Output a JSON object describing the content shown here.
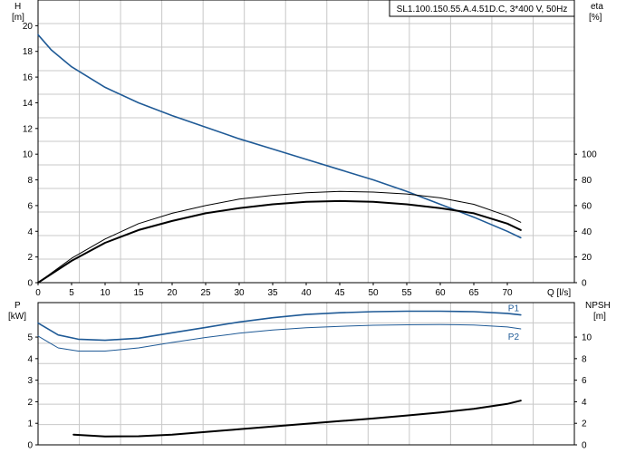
{
  "chart_data": [
    {
      "type": "line",
      "title": "SL1.100.150.55.A.4.51D.C, 3*400 V, 50Hz",
      "xlabel": "Q [l/s]",
      "x_ticks": [
        "0",
        "5",
        "10",
        "15",
        "20",
        "25",
        "30",
        "35",
        "40",
        "45",
        "50",
        "55",
        "60",
        "65",
        "70"
      ],
      "xlim": [
        0,
        80
      ],
      "left_axis": {
        "label_name": "H",
        "label_unit": "[m]",
        "ylim": [
          0,
          22
        ],
        "ticks": [
          "0",
          "2",
          "4",
          "6",
          "8",
          "10",
          "12",
          "14",
          "16",
          "18",
          "20"
        ]
      },
      "right_axis": {
        "label_name": "eta",
        "label_unit": "[%]",
        "ylim": [
          0,
          220
        ],
        "ticks": [
          "0",
          "20",
          "40",
          "60",
          "80",
          "100"
        ]
      },
      "grid": true,
      "series": [
        {
          "axis": "left",
          "color": "#1f5a96",
          "width": 1.6,
          "points": [
            [
              0,
              19.3
            ],
            [
              2,
              18.1
            ],
            [
              5,
              16.8
            ],
            [
              10,
              15.2
            ],
            [
              15,
              14.0
            ],
            [
              20,
              13.0
            ],
            [
              25,
              12.1
            ],
            [
              30,
              11.2
            ],
            [
              35,
              10.4
            ],
            [
              40,
              9.6
            ],
            [
              45,
              8.8
            ],
            [
              50,
              8.0
            ],
            [
              55,
              7.1
            ],
            [
              60,
              6.1
            ],
            [
              65,
              5.1
            ],
            [
              70,
              4.0
            ],
            [
              72,
              3.5
            ]
          ]
        },
        {
          "axis": "right",
          "color": "#000000",
          "width": 1,
          "points": [
            [
              0,
              0
            ],
            [
              5,
              19
            ],
            [
              10,
              34
            ],
            [
              15,
              46
            ],
            [
              20,
              54
            ],
            [
              25,
              60
            ],
            [
              30,
              65
            ],
            [
              35,
              68
            ],
            [
              40,
              70
            ],
            [
              45,
              71
            ],
            [
              50,
              70.5
            ],
            [
              55,
              69
            ],
            [
              60,
              66
            ],
            [
              65,
              61
            ],
            [
              70,
              52
            ],
            [
              72,
              47
            ]
          ]
        },
        {
          "axis": "right",
          "color": "#000000",
          "width": 2,
          "points": [
            [
              0,
              0
            ],
            [
              5,
              17
            ],
            [
              10,
              31
            ],
            [
              15,
              41
            ],
            [
              20,
              48
            ],
            [
              25,
              54
            ],
            [
              30,
              58
            ],
            [
              35,
              61
            ],
            [
              40,
              63
            ],
            [
              45,
              63.5
            ],
            [
              50,
              63
            ],
            [
              55,
              61
            ],
            [
              60,
              58
            ],
            [
              65,
              54
            ],
            [
              70,
              46
            ],
            [
              72,
              41
            ]
          ]
        }
      ]
    },
    {
      "type": "line",
      "xlim": [
        0,
        80
      ],
      "left_axis": {
        "label_name": "P",
        "label_unit": "[kW]",
        "ylim": [
          0,
          6.6
        ],
        "ticks": [
          "0",
          "1",
          "2",
          "3",
          "4",
          "5"
        ]
      },
      "right_axis": {
        "label_name": "NPSH",
        "label_unit": "[m]",
        "ylim": [
          0,
          13.2
        ],
        "ticks": [
          "0",
          "2",
          "4",
          "6",
          "8",
          "10"
        ]
      },
      "grid": true,
      "series": [
        {
          "name": "P1",
          "axis": "left",
          "color": "#1f5a96",
          "width": 1.6,
          "points": [
            [
              0,
              5.65
            ],
            [
              3,
              5.1
            ],
            [
              6,
              4.9
            ],
            [
              10,
              4.85
            ],
            [
              15,
              4.95
            ],
            [
              20,
              5.2
            ],
            [
              25,
              5.45
            ],
            [
              30,
              5.7
            ],
            [
              35,
              5.9
            ],
            [
              40,
              6.05
            ],
            [
              45,
              6.13
            ],
            [
              50,
              6.18
            ],
            [
              55,
              6.2
            ],
            [
              60,
              6.2
            ],
            [
              65,
              6.18
            ],
            [
              70,
              6.1
            ],
            [
              72,
              6.03
            ]
          ]
        },
        {
          "name": "P2",
          "axis": "left",
          "color": "#1f5a96",
          "width": 1,
          "points": [
            [
              0,
              5.05
            ],
            [
              3,
              4.5
            ],
            [
              6,
              4.35
            ],
            [
              10,
              4.35
            ],
            [
              15,
              4.5
            ],
            [
              20,
              4.75
            ],
            [
              25,
              4.98
            ],
            [
              30,
              5.18
            ],
            [
              35,
              5.33
            ],
            [
              40,
              5.43
            ],
            [
              45,
              5.5
            ],
            [
              50,
              5.55
            ],
            [
              55,
              5.57
            ],
            [
              60,
              5.58
            ],
            [
              65,
              5.56
            ],
            [
              70,
              5.47
            ],
            [
              72,
              5.38
            ]
          ]
        },
        {
          "axis": "right",
          "color": "#000000",
          "width": 2,
          "points": [
            [
              5.3,
              0.95
            ],
            [
              10,
              0.78
            ],
            [
              15,
              0.8
            ],
            [
              20,
              0.95
            ],
            [
              25,
              1.2
            ],
            [
              30,
              1.45
            ],
            [
              35,
              1.7
            ],
            [
              40,
              1.95
            ],
            [
              45,
              2.2
            ],
            [
              50,
              2.45
            ],
            [
              55,
              2.72
            ],
            [
              60,
              3.0
            ],
            [
              65,
              3.35
            ],
            [
              70,
              3.8
            ],
            [
              72,
              4.1
            ]
          ]
        }
      ]
    }
  ]
}
